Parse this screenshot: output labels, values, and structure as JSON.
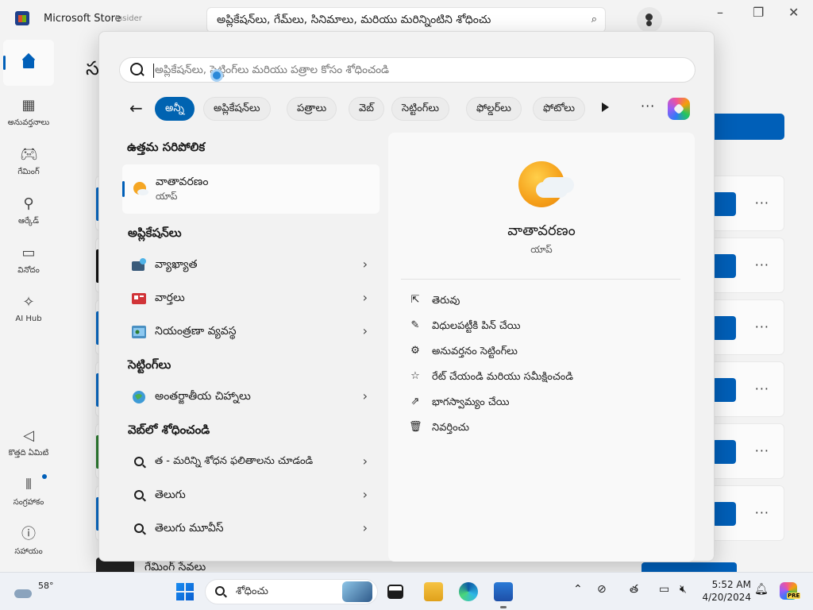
{
  "store": {
    "title": "Microsoft Store",
    "badge": "Insider",
    "search_value": "అప్లికేషన్‌లు, గేమ్‌లు, సినిమాలు, మరియు మరిన్నింటిని శోధించు",
    "heading_partial": "స",
    "nav": [
      {
        "label": "",
        "icon": "home-icon"
      },
      {
        "label": "అనువర్తనాలు",
        "icon": "apps-icon"
      },
      {
        "label": "గేమింగ్",
        "icon": "gamepad-icon"
      },
      {
        "label": "ఆర్కేడ్",
        "icon": "joystick-icon"
      },
      {
        "label": "వినోదం",
        "icon": "clapper-icon"
      },
      {
        "label": "AI Hub",
        "icon": "sparkle-icon"
      },
      {
        "label": "కొత్తది ఏమిటి",
        "icon": "megaphone-icon"
      },
      {
        "label": "సంగ్రహాకం",
        "icon": "library-icon"
      },
      {
        "label": "సహాయం",
        "icon": "help-icon"
      }
    ],
    "bottom_item": "గేమింగ్ సేవలు"
  },
  "flyout": {
    "search_placeholder": "అప్లికేషన్‌లు, సెట్టింగ్‌లు మరియు పత్రాల కోసం శోధించండి",
    "chips": [
      "అన్నీ",
      "అప్లికేషన్‌లు",
      "పత్రాలు",
      "వెబ్",
      "సెట్టింగ్‌లు",
      "ఫోల్డర్‌లు",
      "ఫోటోలు"
    ],
    "best_match_heading": "ఉత్తమ సరిపోలిక",
    "best_match": {
      "name": "వాతావరణం",
      "type": "యాప్"
    },
    "apps_heading": "అప్లికేషన్‌లు",
    "apps": [
      {
        "label": "వ్యాఖ్యాత",
        "icon": "narrator-icon"
      },
      {
        "label": "వార్తలు",
        "icon": "news-icon"
      },
      {
        "label": "నియంత్రణా వ్యవస్థ",
        "icon": "control-panel-icon"
      }
    ],
    "settings_heading": "సెట్టింగ్‌లు",
    "settings": [
      {
        "label": "అంతర్జాతీయ చిహ్నాలు",
        "icon": "globe-icon"
      }
    ],
    "web_heading": "వెబ్‌లో శోధించండి",
    "web": [
      {
        "label": "త - మరిన్ని శోధన ఫలితాలను చూడండి"
      },
      {
        "label": "తెలుగు"
      },
      {
        "label": "తెలుగు మూవీస్"
      }
    ],
    "preview": {
      "name": "వాతావరణం",
      "type": "యాప్",
      "actions": [
        {
          "label": "తెరువు",
          "icon": "open-external-icon"
        },
        {
          "label": "విధులపట్టీకి పిన్ చేయి",
          "icon": "pin-icon"
        },
        {
          "label": "అనువర్తనం సెట్టింగ్‌లు",
          "icon": "gear-icon"
        },
        {
          "label": "రేట్ చేయండి మరియు సమీక్షించండి",
          "icon": "star-icon"
        },
        {
          "label": "భాగస్వామ్యం చేయి",
          "icon": "share-icon"
        },
        {
          "label": "నివర్తించు",
          "icon": "trash-icon"
        }
      ]
    }
  },
  "taskbar": {
    "temperature": "58°",
    "search_label": "శోధించు",
    "tray_lang": "త",
    "time": "5:52 AM",
    "date": "4/20/2024",
    "copilot_badge": "PRE"
  }
}
